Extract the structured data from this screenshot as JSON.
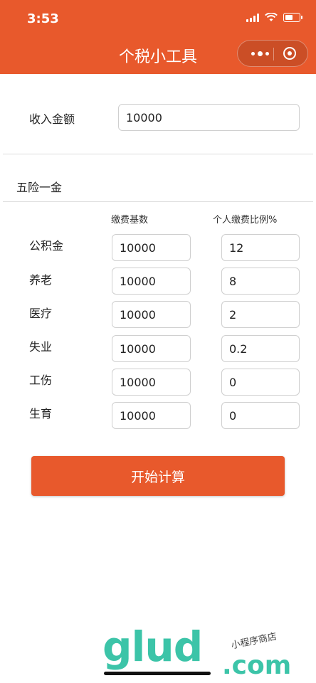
{
  "status_bar": {
    "time": "3:53"
  },
  "header": {
    "title": "个税小工具"
  },
  "income": {
    "label": "收入金额",
    "value": "10000"
  },
  "insurance": {
    "section_title": "五险一金",
    "col_base": "缴费基数",
    "col_rate": "个人缴费比例%",
    "rows": [
      {
        "label": "公积金",
        "base": "10000",
        "rate": "12"
      },
      {
        "label": "养老",
        "base": "10000",
        "rate": "8"
      },
      {
        "label": "医疗",
        "base": "10000",
        "rate": "2"
      },
      {
        "label": "失业",
        "base": "10000",
        "rate": "0.2"
      },
      {
        "label": "工伤",
        "base": "10000",
        "rate": "0"
      },
      {
        "label": "生育",
        "base": "10000",
        "rate": "0"
      }
    ]
  },
  "actions": {
    "start_label": "开始计算"
  },
  "watermark": {
    "logo": "glud",
    "domain": ".com",
    "tagline": "小程序商店"
  },
  "colors": {
    "primary": "#e8592c",
    "watermark": "#3cc4a8"
  }
}
